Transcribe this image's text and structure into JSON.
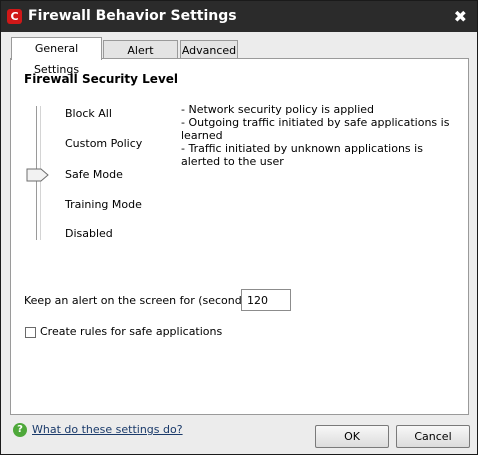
{
  "window": {
    "title": "Firewall Behavior Settings",
    "logo_letter": "C",
    "close_glyph": "✖"
  },
  "tabs": [
    {
      "label": "General Settings",
      "active": true
    },
    {
      "label": "Alert Settings",
      "active": false
    },
    {
      "label": "Advanced",
      "active": false
    }
  ],
  "security": {
    "title": "Firewall Security Level",
    "levels": [
      "Block All",
      "Custom Policy",
      "Safe Mode",
      "Training Mode",
      "Disabled"
    ],
    "selected": "Safe Mode",
    "description": [
      "- Network security policy is applied",
      "- Outgoing traffic initiated by safe applications is learned",
      "- Traffic initiated by unknown applications is alerted to the user"
    ]
  },
  "alert": {
    "label": "Keep an alert on the screen for (seconds):",
    "value": "120"
  },
  "checkbox": {
    "label": "Create rules for safe applications",
    "checked": false
  },
  "footer": {
    "help_icon_glyph": "?",
    "help_link": "What do these settings do?",
    "ok_label": "OK",
    "cancel_label": "Cancel"
  },
  "colors": {
    "titlebar": "#2b2b2b",
    "logo": "#d01818",
    "help_icon": "#4ea83a"
  }
}
